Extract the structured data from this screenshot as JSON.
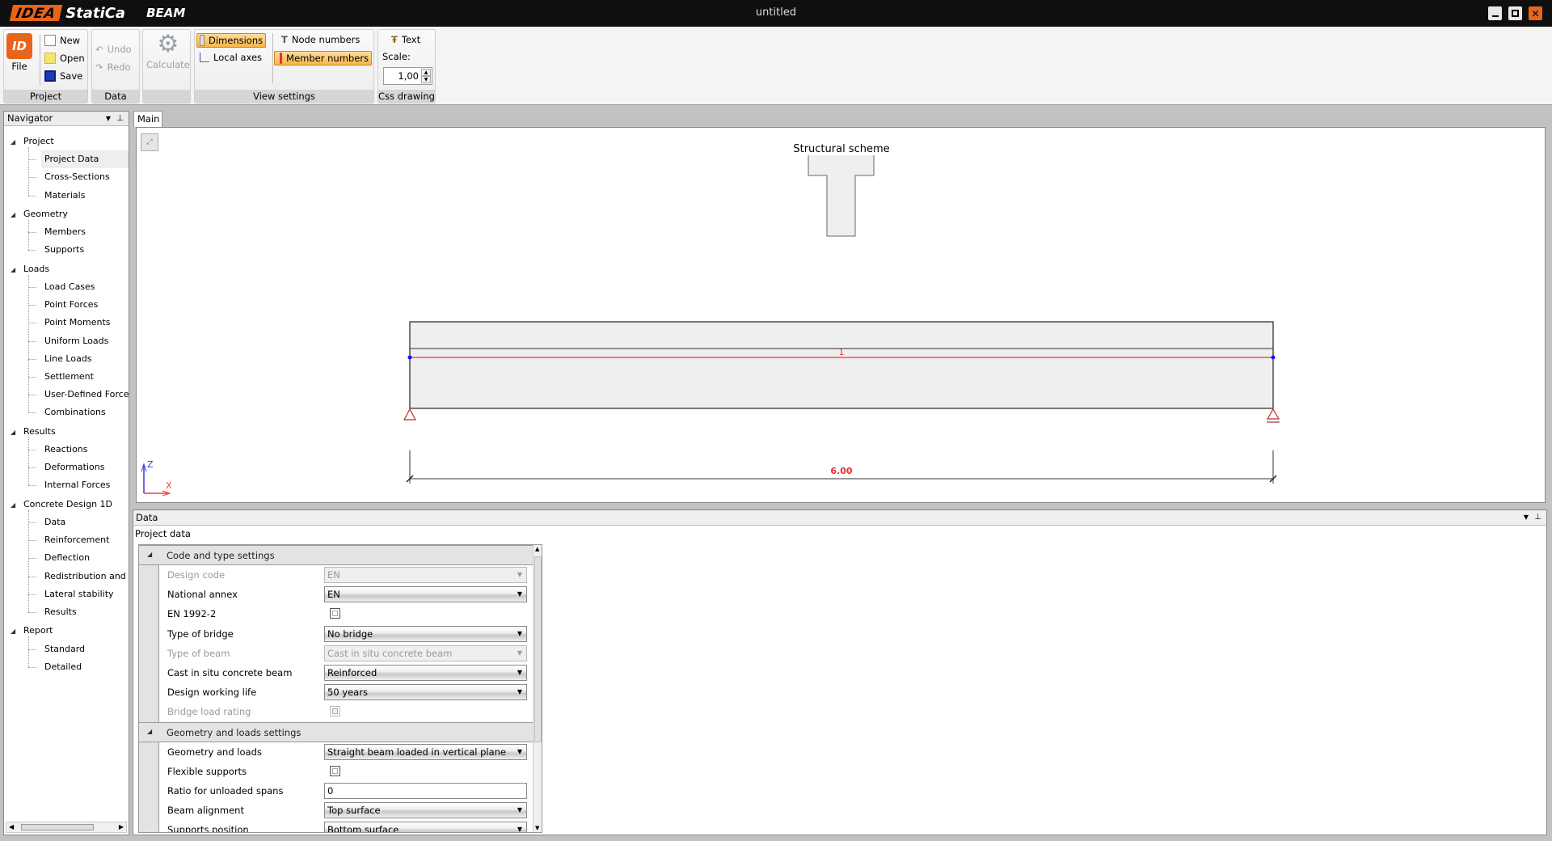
{
  "app": {
    "title": "untitled",
    "logo_idea": "IDEA",
    "logo_statica": "StatiCa",
    "product": "BEAM"
  },
  "ribbon": {
    "file": "File",
    "new": "New",
    "open": "Open",
    "save": "Save",
    "project_group": "Project",
    "undo": "Undo",
    "redo": "Redo",
    "data_group": "Data",
    "calculate": "Calculate",
    "dimensions": "Dimensions",
    "local_axes": "Local axes",
    "node_numbers": "Node numbers",
    "member_numbers": "Member numbers",
    "view_group": "View settings",
    "text": "Text",
    "scale_label": "Scale:",
    "scale_value": "1,00",
    "css_group": "Css drawing"
  },
  "navigator": {
    "title": "Navigator",
    "tree": [
      {
        "label": "Project",
        "items": [
          "Project Data",
          "Cross-Sections",
          "Materials"
        ]
      },
      {
        "label": "Geometry",
        "items": [
          "Members",
          "Supports"
        ]
      },
      {
        "label": "Loads",
        "items": [
          "Load Cases",
          "Point Forces",
          "Point Moments",
          "Uniform Loads",
          "Line Loads",
          "Settlement",
          "User-Defined Forces",
          "Combinations"
        ]
      },
      {
        "label": "Results",
        "items": [
          "Reactions",
          "Deformations",
          "Internal Forces"
        ]
      },
      {
        "label": "Concrete Design 1D",
        "items": [
          "Data",
          "Reinforcement",
          "Deflection",
          "Redistribution and r",
          "Lateral stability",
          "Results"
        ]
      },
      {
        "label": "Report",
        "items": [
          "Standard",
          "Detailed"
        ]
      }
    ],
    "selected": "Project Data"
  },
  "main": {
    "tab": "Main",
    "scheme_title": "Structural scheme",
    "member_number": "1",
    "span_dimension": "6.00",
    "axis_z": "Z",
    "axis_x": "X"
  },
  "data_panel": {
    "title": "Data",
    "subtitle": "Project data",
    "sections": [
      {
        "title": "Code and type settings",
        "rows": [
          {
            "label": "Design code",
            "type": "select",
            "value": "EN",
            "disabled": true
          },
          {
            "label": "National annex",
            "type": "select",
            "value": "EN"
          },
          {
            "label": "EN 1992-2",
            "type": "checkbox",
            "value": ""
          },
          {
            "label": "Type of bridge",
            "type": "select",
            "value": "No bridge"
          },
          {
            "label": "Type of beam",
            "type": "select",
            "value": "Cast in situ concrete beam",
            "disabled": true
          },
          {
            "label": "Cast in situ concrete beam",
            "type": "select",
            "value": "Reinforced"
          },
          {
            "label": "Design working life",
            "type": "select",
            "value": "50 years"
          },
          {
            "label": "Bridge load rating",
            "type": "checkbox",
            "value": "",
            "disabled": true
          }
        ]
      },
      {
        "title": "Geometry and loads settings",
        "rows": [
          {
            "label": "Geometry and loads",
            "type": "select",
            "value": "Straight beam loaded in vertical plane"
          },
          {
            "label": "Flexible supports",
            "type": "checkbox",
            "value": ""
          },
          {
            "label": "Ratio for unloaded spans",
            "type": "text",
            "value": "0"
          },
          {
            "label": "Beam alignment",
            "type": "select",
            "value": "Top surface"
          },
          {
            "label": "Supports position",
            "type": "select",
            "value": "Bottom surface"
          }
        ]
      }
    ]
  },
  "colors": {
    "accent": "#e8641b",
    "member": "#e53030",
    "node": "#1010ff",
    "support": "#b03030"
  }
}
